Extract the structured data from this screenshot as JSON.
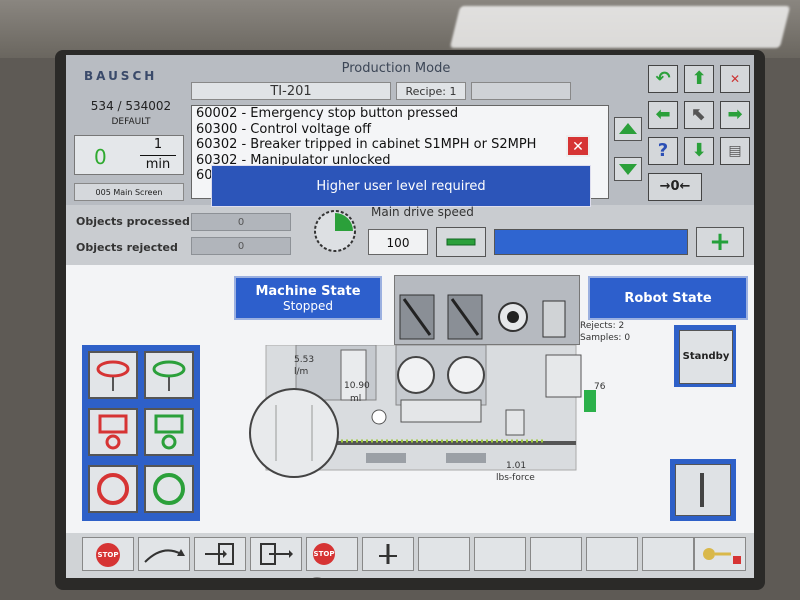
{
  "header": {
    "logo": "BAUSCH",
    "title": "Production Mode",
    "station": "TI-201",
    "recipe": "Recipe: 1",
    "counter": "534 / 534002",
    "counter_sub": "DEFAULT",
    "rate_value": "0",
    "rate_unit_top": "1",
    "rate_unit_bottom": "min",
    "screen_tag": "005 Main Screen"
  },
  "alarms": [
    "60002 - Emergency stop button pressed",
    "60300 - Control voltage off",
    "60302 - Breaker tripped in cabinet S1MPH or S2MPH",
    "60302 - Manipulator unlocked",
    "60"
  ],
  "popup": "Higher user level required",
  "stats": {
    "processed_label": "Objects processed",
    "processed_value": "0",
    "rejected_label": "Objects rejected",
    "rejected_value": "0"
  },
  "speed": {
    "caption": "Main drive speed",
    "value": "100",
    "level": 1.0
  },
  "machine_state": {
    "title": "Machine State",
    "value": "Stopped"
  },
  "robot_state": {
    "title": "Robot State"
  },
  "rejects": {
    "rejects_label": "Rejects: 2",
    "samples_label": "Samples: 0"
  },
  "standby_label": "Standby",
  "readouts": {
    "flow": "5.53",
    "flow_unit": "l/m",
    "volume": "10.90",
    "volume_unit": "ml",
    "level": "76",
    "force": "1.01",
    "force_unit": "lbs-force"
  },
  "bottom": {
    "stop1": "STOP",
    "stop2": "STOP"
  },
  "colors": {
    "accent": "#2d5fcc",
    "green": "#2ba03a",
    "red": "#d63434"
  }
}
